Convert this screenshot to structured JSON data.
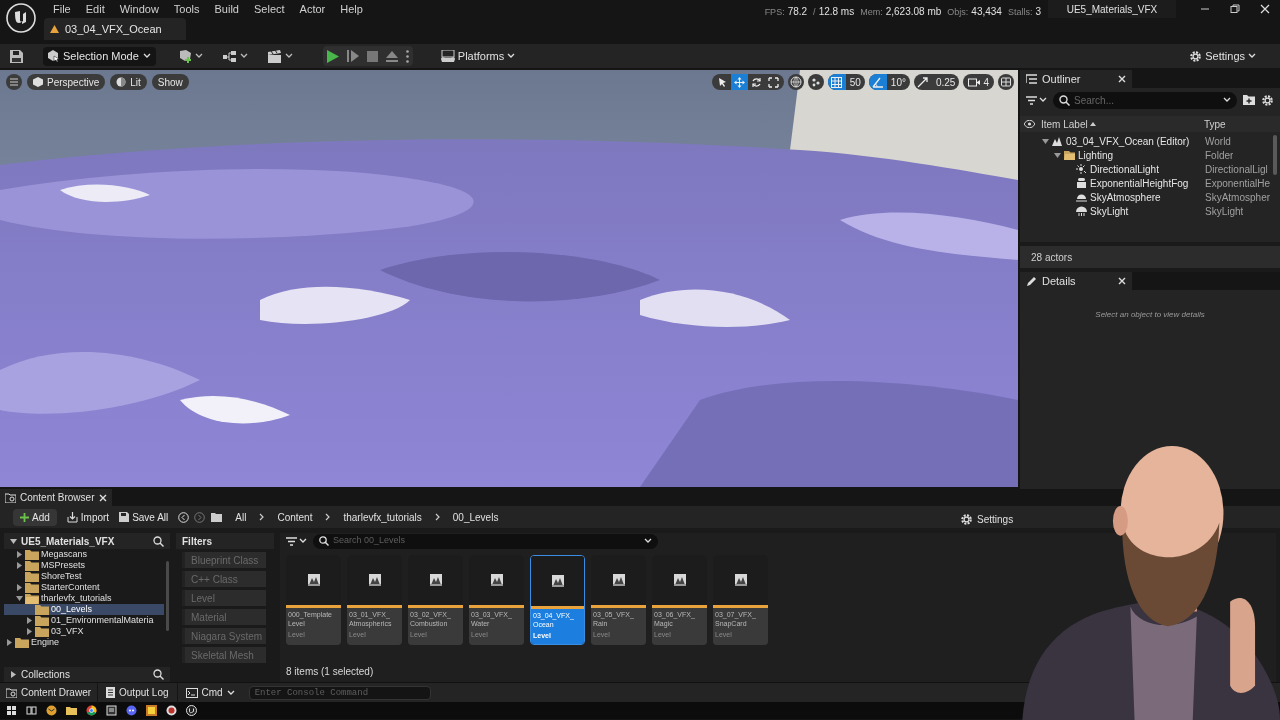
{
  "menu": [
    "File",
    "Edit",
    "Window",
    "Tools",
    "Build",
    "Select",
    "Actor",
    "Help"
  ],
  "document_tab": {
    "label": "03_04_VFX_Ocean"
  },
  "stats": [
    {
      "label": "FPS:",
      "value": "78.2"
    },
    {
      "label": "/",
      "value": "12.8 ms"
    },
    {
      "label": "Mem:",
      "value": "2,623.08 mb"
    },
    {
      "label": "Objs:",
      "value": "43,434"
    },
    {
      "label": "Stalls:",
      "value": "3"
    }
  ],
  "project_name": "UE5_Materials_VFX",
  "toolbar": {
    "mode": "Selection Mode",
    "platforms": "Platforms",
    "settings": "Settings"
  },
  "viewport": {
    "view_buttons": [
      "Perspective",
      "Lit",
      "Show"
    ],
    "transform_tools": [
      {
        "kind": "select",
        "selected": false
      },
      {
        "kind": "move",
        "selected": true
      },
      {
        "kind": "rotate",
        "selected": false
      },
      {
        "kind": "scale",
        "selected": false
      }
    ],
    "grid_snap": {
      "value": "50",
      "on": true
    },
    "rotation_snap": {
      "value": "10°",
      "on": true
    },
    "scale_snap": {
      "value": "0.25",
      "on": false
    },
    "camera_speed": "4"
  },
  "outliner": {
    "title": "Outliner",
    "search_placeholder": "Search...",
    "columns": [
      "Item Label",
      "Type"
    ],
    "tree": [
      {
        "label": "03_04_VFX_Ocean (Editor)",
        "type": "World",
        "kind": "world",
        "expanded": true,
        "children": [
          {
            "label": "Lighting",
            "type": "Folder",
            "kind": "folder",
            "expanded": true,
            "children": [
              {
                "label": "DirectionalLight",
                "type": "DirectionalLigl",
                "kind": "light"
              },
              {
                "label": "ExponentialHeightFog",
                "type": "ExponentialHe",
                "kind": "fog"
              },
              {
                "label": "SkyAtmosphere",
                "type": "SkyAtmospher",
                "kind": "sky"
              },
              {
                "label": "SkyLight",
                "type": "SkyLight",
                "kind": "skylight"
              }
            ]
          }
        ]
      }
    ],
    "footer": "28 actors"
  },
  "details": {
    "title": "Details",
    "empty_message": "Select an object to view details"
  },
  "content_browser": {
    "title": "Content Browser",
    "add": "Add",
    "import": "Import",
    "save_all": "Save All",
    "path": [
      "All",
      "Content",
      "tharlevfx_tutorials",
      "00_Levels"
    ],
    "settings": "Settings",
    "tree": [
      {
        "label": "UE5_Materials_VFX",
        "expanded": true,
        "children": [
          {
            "label": "Megascans",
            "expanded": false,
            "selected": false
          },
          {
            "label": "MSPresets",
            "expanded": false,
            "selected": false
          },
          {
            "label": "ShoreTest",
            "selected": false
          },
          {
            "label": "StarterContent",
            "expanded": false,
            "selected": false
          },
          {
            "label": "tharlevfx_tutorials",
            "expanded": true,
            "selected": false,
            "children": [
              {
                "label": "00_Levels",
                "selected": true
              },
              {
                "label": "01_EnvironmentalMateria",
                "expanded": false,
                "selected": false
              },
              {
                "label": "03_VFX",
                "expanded": false,
                "selected": false
              }
            ]
          }
        ]
      },
      {
        "label": "Engine",
        "expanded": false,
        "selected": false
      }
    ],
    "collections": "Collections",
    "filters_title": "Filters",
    "filters": [
      "Blueprint Class",
      "C++ Class",
      "Level",
      "Material",
      "Niagara System",
      "Skeletal Mesh"
    ],
    "search_placeholder": "Search 00_Levels",
    "assets": [
      {
        "name": "000_Template Level",
        "type": "Level",
        "selected": false
      },
      {
        "name": "03_01_VFX_ Atmospherics",
        "type": "Level",
        "selected": false
      },
      {
        "name": "03_02_VFX_ Combustion",
        "type": "Level",
        "selected": false
      },
      {
        "name": "03_03_VFX_ Water",
        "type": "Level",
        "selected": false
      },
      {
        "name": "03_04_VFX_ Ocean",
        "type": "Level",
        "selected": true
      },
      {
        "name": "03_05_VFX_ Rain",
        "type": "Level",
        "selected": false
      },
      {
        "name": "03_06_VFX_ Magic",
        "type": "Level",
        "selected": false
      },
      {
        "name": "03_07_VFX_ SnapCard",
        "type": "Level",
        "selected": false
      }
    ],
    "item_count": "8 items (1 selected)"
  },
  "status_bar": {
    "content_drawer": "Content Drawer",
    "output_log": "Output Log",
    "cmd": "Cmd",
    "console_placeholder": "Enter Console Command"
  }
}
